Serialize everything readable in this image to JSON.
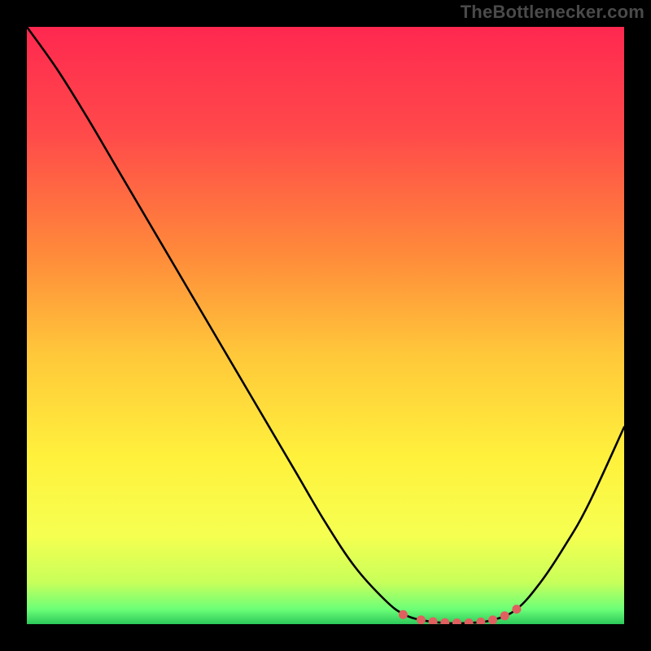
{
  "watermark": "TheBottlenecker.com",
  "chart_data": {
    "type": "line",
    "title": "",
    "xlabel": "",
    "ylabel": "",
    "xlim": [
      0,
      100
    ],
    "ylim": [
      0,
      100
    ],
    "x": [
      0,
      5,
      10,
      15,
      20,
      25,
      30,
      35,
      40,
      45,
      50,
      55,
      60,
      63,
      66,
      70,
      74,
      78,
      82,
      86,
      90,
      94,
      100
    ],
    "y": [
      100,
      93,
      85,
      76.5,
      68,
      59.5,
      51,
      42.5,
      34,
      25.5,
      17,
      9.5,
      4,
      1.7,
      0.7,
      0.2,
      0.2,
      0.7,
      2.5,
      7,
      13,
      20,
      33
    ],
    "marker_points_x": [
      63,
      66,
      68,
      70,
      72,
      74,
      76,
      78,
      80,
      82
    ],
    "marker_points_y": [
      1.6,
      0.7,
      0.4,
      0.25,
      0.2,
      0.2,
      0.35,
      0.7,
      1.4,
      2.5
    ],
    "gradient_stops": [
      {
        "offset": 0.0,
        "color": "#ff2850"
      },
      {
        "offset": 0.18,
        "color": "#ff4a4a"
      },
      {
        "offset": 0.38,
        "color": "#ff8a3a"
      },
      {
        "offset": 0.55,
        "color": "#ffc83a"
      },
      {
        "offset": 0.72,
        "color": "#fff13c"
      },
      {
        "offset": 0.85,
        "color": "#f6ff50"
      },
      {
        "offset": 0.93,
        "color": "#c8ff5a"
      },
      {
        "offset": 0.975,
        "color": "#6cff78"
      },
      {
        "offset": 1.0,
        "color": "#2cc85a"
      }
    ],
    "curve_color": "#000000",
    "marker_color": "#e06060"
  }
}
